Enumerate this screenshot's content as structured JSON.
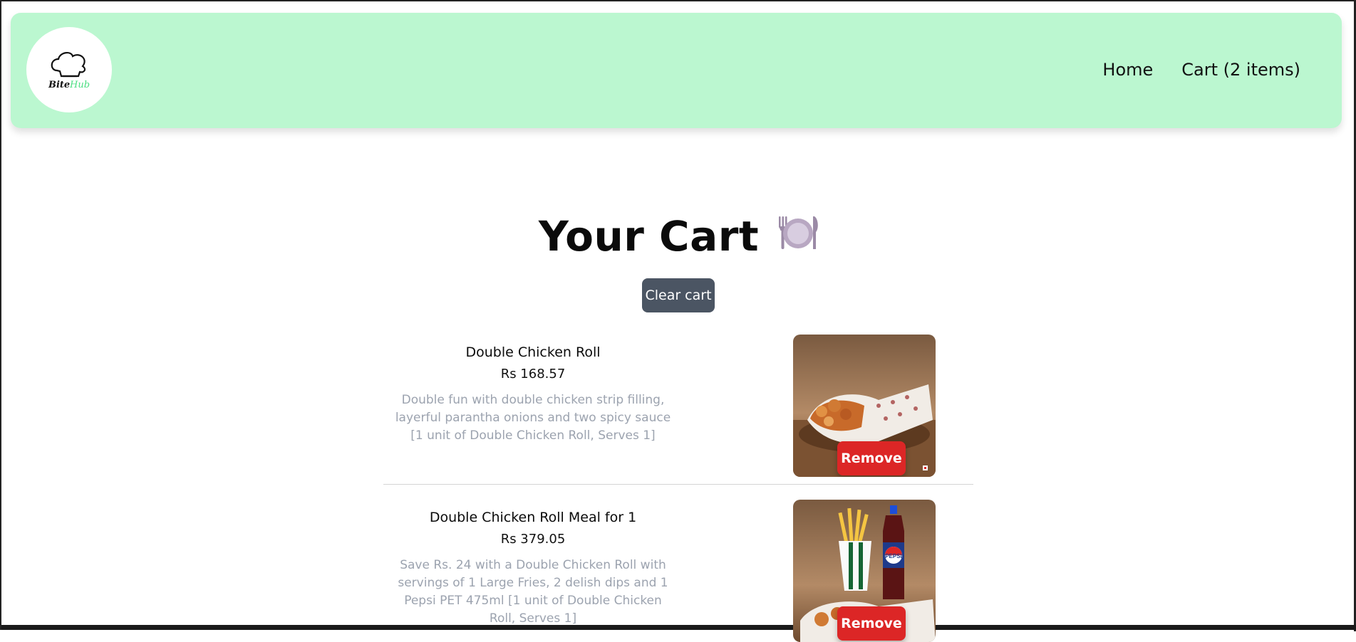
{
  "header": {
    "logo": {
      "word1": "Bite",
      "word2": "Hub",
      "icon": "chef-hat-icon"
    },
    "nav": {
      "home": "Home",
      "cart": "Cart (2 items)"
    }
  },
  "cart": {
    "title": "Your Cart",
    "title_icon": "fork-knife-plate-icon",
    "clear_label": "Clear cart",
    "items": [
      {
        "name": "Double Chicken Roll",
        "price": "Rs 168.57",
        "description": "Double fun with double chicken strip filling, layerful parantha onions and two spicy sauce [1 unit of Double Chicken Roll, Serves 1]",
        "remove_label": "Remove"
      },
      {
        "name": "Double Chicken Roll Meal for 1",
        "price": "Rs 379.05",
        "description": "Save Rs. 24 with a Double Chicken Roll with servings of 1 Large Fries, 2 delish dips and 1 Pepsi PET 475ml [1 unit of Double Chicken Roll, Serves 1]",
        "remove_label": "Remove",
        "photo_text": "PEPSI"
      }
    ]
  },
  "colors": {
    "header_bg": "#bbf7d0",
    "clear_button": "#4b5563",
    "remove_button": "#dc2626",
    "logo_accent": "#4ade80"
  }
}
